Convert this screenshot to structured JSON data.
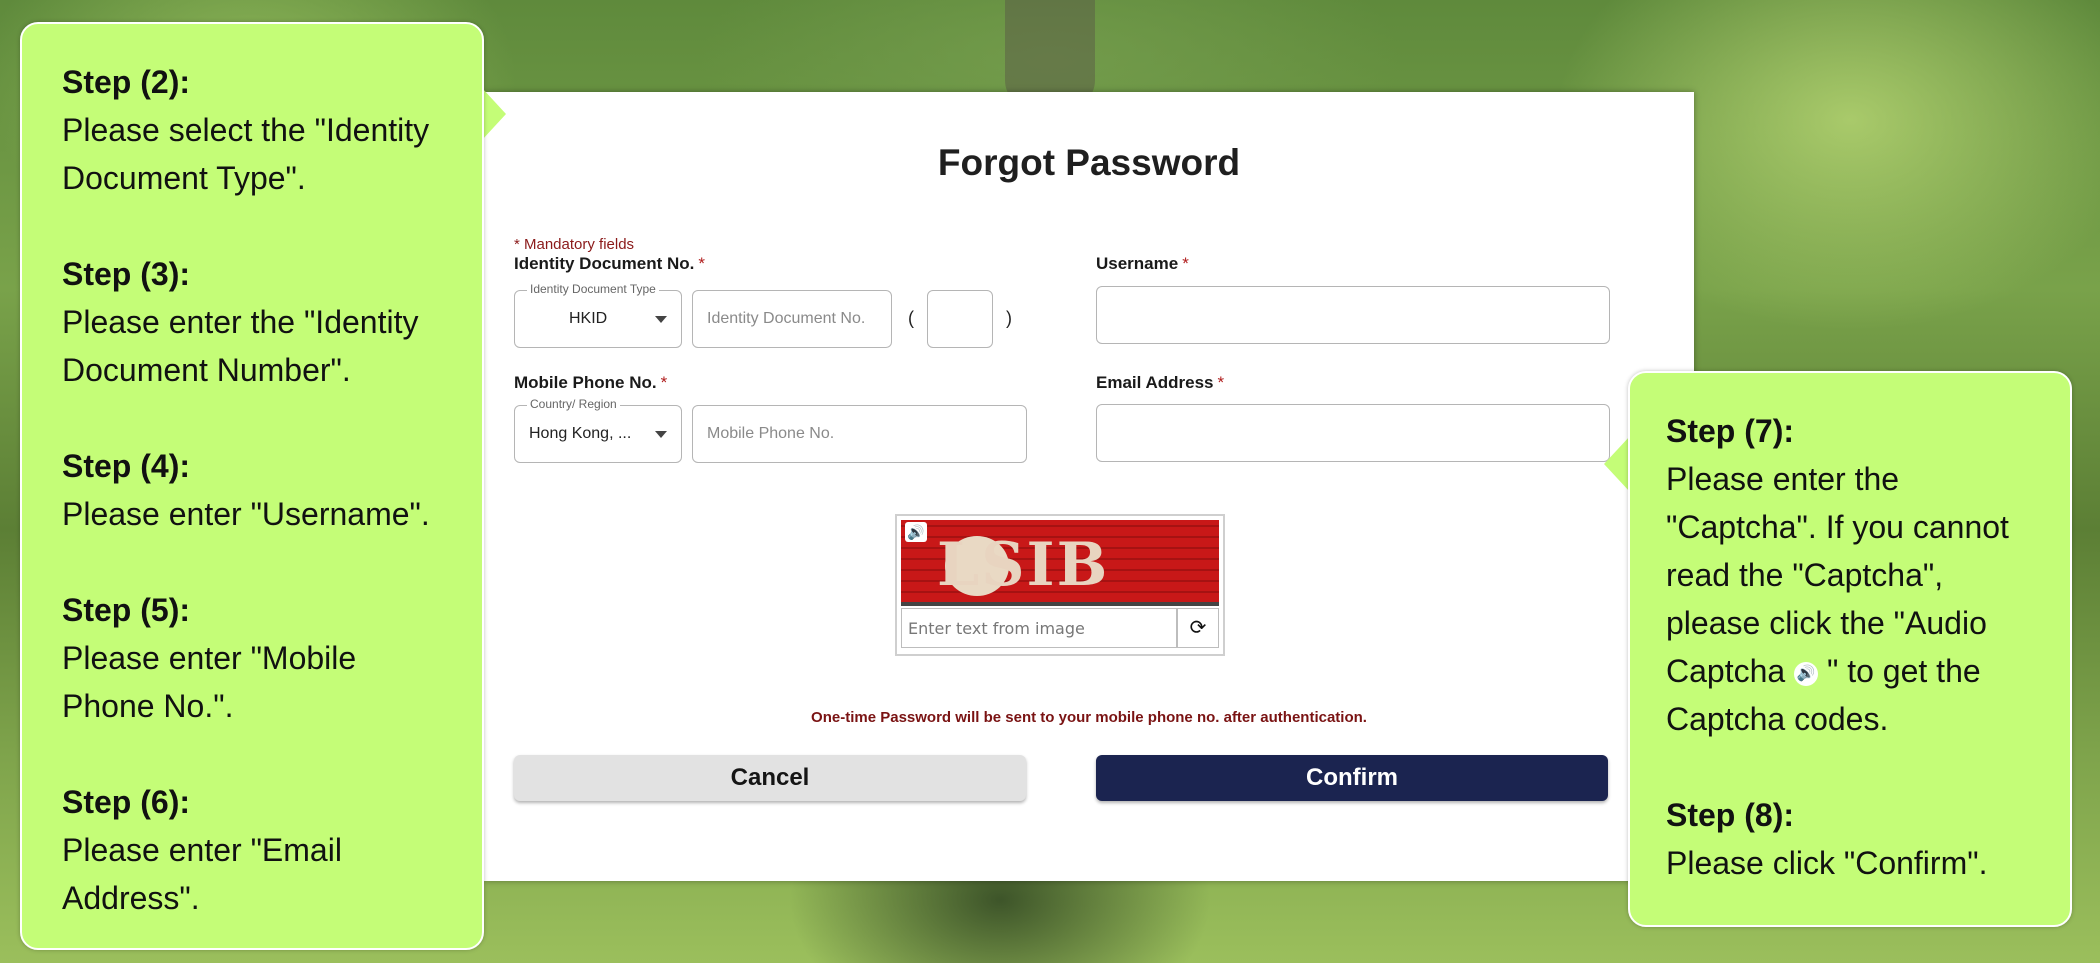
{
  "form": {
    "title": "Forgot Password",
    "mandatory_note": "* Mandatory fields",
    "required_marker": "*",
    "id_doc_label": "Identity Document No.",
    "id_doc_type_legend": "Identity Document Type",
    "id_doc_type_value": "HKID",
    "id_doc_no_placeholder": "Identity Document No.",
    "check_digit_open": "(",
    "check_digit_close": ")",
    "username_label": "Username",
    "mobile_label": "Mobile Phone No.",
    "country_legend": "Country/ Region",
    "country_value": "Hong Kong, ...",
    "mobile_placeholder": "Mobile Phone No.",
    "email_label": "Email Address",
    "captcha_text": "LSIB",
    "captcha_placeholder": "Enter text from image",
    "otp_note": "One-time Password will be sent to your mobile phone no. after authentication.",
    "cancel_label": "Cancel",
    "confirm_label": "Confirm"
  },
  "left_callout": {
    "steps": [
      {
        "title": "Step (2):",
        "lines": [
          "Please select the \"Identity",
          "Document Type\"."
        ]
      },
      {
        "title": "Step (3):",
        "lines": [
          "Please enter the \"Identity",
          "Document Number\"."
        ]
      },
      {
        "title": "Step (4):",
        "lines": [
          "Please enter \"Username\"."
        ]
      },
      {
        "title": "Step (5):",
        "lines": [
          "Please enter \"Mobile",
          "Phone No.\"."
        ]
      },
      {
        "title": "Step (6):",
        "lines": [
          "Please enter \"Email",
          "Address\"."
        ]
      }
    ]
  },
  "right_callout": {
    "step7_title": "Step (7):",
    "step7_lines": [
      "Please enter the",
      "\"Captcha\".  If you cannot",
      "read the \"Captcha\",",
      "please click the \"Audio"
    ],
    "step7_line5_pre": "Captcha",
    "step7_line5_post": "\" to get the",
    "step7_line6": "Captcha codes.",
    "step8_title": "Step (8):",
    "step8_line": "Please click \"Confirm\"."
  },
  "colors": {
    "callout": "#c4fd77",
    "confirm_button": "#1b2450",
    "required": "#b01c1c"
  }
}
